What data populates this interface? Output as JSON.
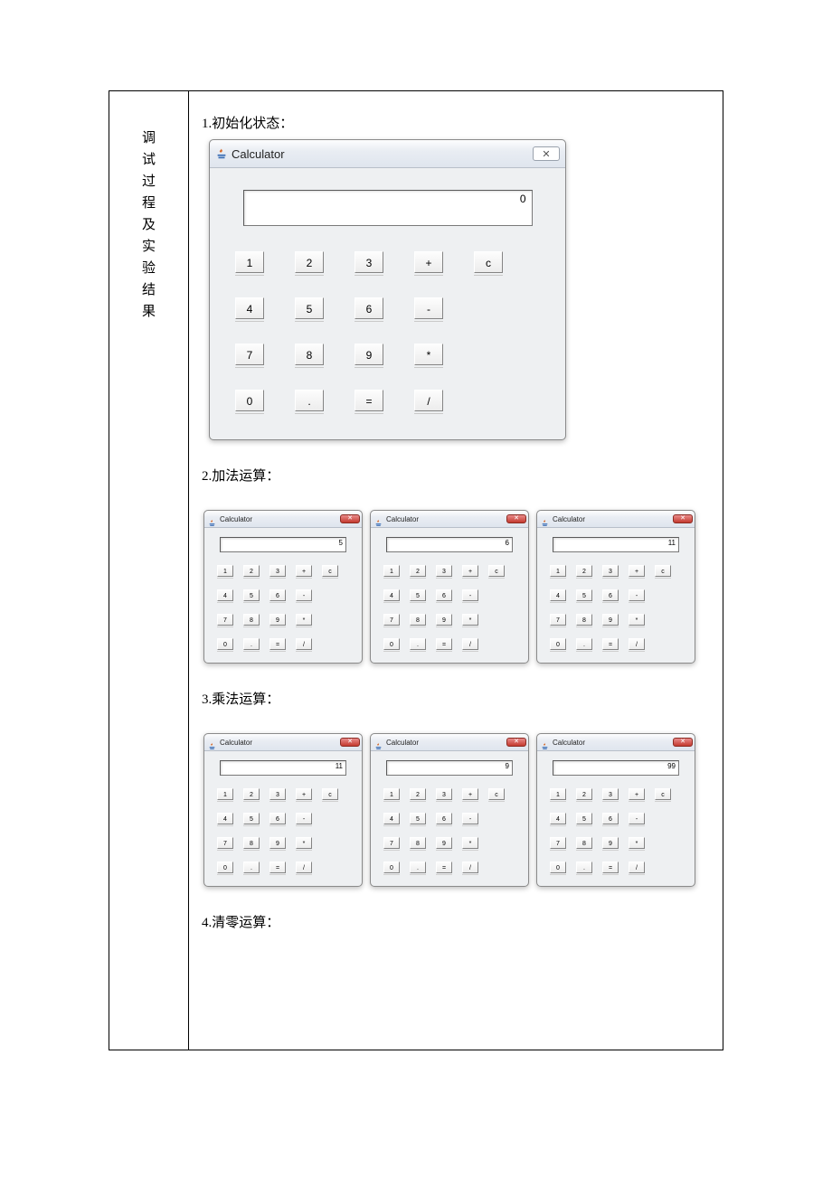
{
  "doc": {
    "left_label": "调试过程及实验结果",
    "section1_title": "1.初始化状态：",
    "section2_title": "2.加法运算：",
    "section3_title": "3.乘法运算：",
    "section4_title": "4.清零运算："
  },
  "keys": {
    "k1": "1",
    "k2": "2",
    "k3": "3",
    "kplus": "+",
    "kc": "c",
    "k4": "4",
    "k5": "5",
    "k6": "6",
    "kminus": "-",
    "k7": "7",
    "k8": "8",
    "k9": "9",
    "kmul": "*",
    "k0": "0",
    "kdot": ".",
    "keq": "=",
    "kdiv": "/"
  },
  "large_calc": {
    "title": "Calculator",
    "close_glyph": "✕",
    "display": "0"
  },
  "add_row": {
    "title": "Calculator",
    "close_glyph": "✕",
    "c1_display": "5",
    "c2_display": "6",
    "c3_display": "11"
  },
  "mul_row": {
    "title": "Calculator",
    "close_glyph": "✕",
    "c1_display": "11",
    "c2_display": "9",
    "c3_display": "99"
  }
}
